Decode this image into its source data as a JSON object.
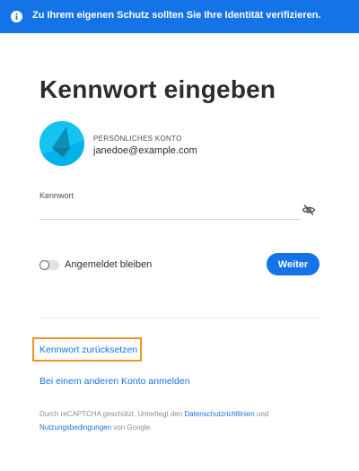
{
  "banner": {
    "icon": "info-icon",
    "text": "Zu Ihrem eigenen Schutz sollten Sie Ihre Identität verifizieren.",
    "color": "#1473e6"
  },
  "title": "Kennwort eingeben",
  "account": {
    "avatar_icon": "account-avatar",
    "type_label": "PERSÖNLICHES KONTO",
    "email": "janedoe@example.com"
  },
  "password": {
    "label": "Kennwort",
    "value": "",
    "visibility_icon": "eye-slash-icon"
  },
  "stay_signed_in": {
    "label": "Angemeldet bleiben",
    "checked": false
  },
  "continue_button": {
    "label": "Weiter",
    "color": "#1473e6"
  },
  "links": {
    "reset_password": "Kennwort zurücksetzen",
    "other_account": "Bei einem anderen Konto anmelden"
  },
  "footer": {
    "text_1": "Durch reCAPTCHA geschützt. Unterliegt den ",
    "privacy_link": "Datenschutzrichtlinien",
    "text_2": " und ",
    "terms_link": "Nutzungsbedingungen",
    "text_3": " von Google."
  },
  "highlight_color": "#f29423"
}
